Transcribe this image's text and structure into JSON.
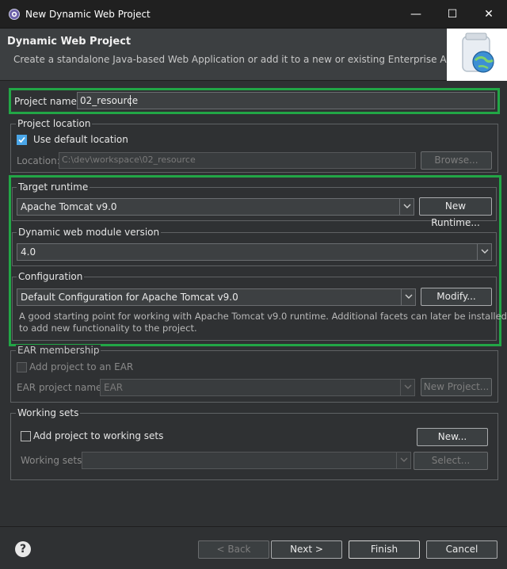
{
  "window": {
    "title": "New Dynamic Web Project",
    "minimize_glyph": "—",
    "maximize_glyph": "☐",
    "close_glyph": "✕"
  },
  "header": {
    "title": "Dynamic Web Project",
    "description": "Create a standalone Java-based Web Application or add it to a new or existing Enterprise Application."
  },
  "project_name": {
    "label": "Project name:",
    "value": "02_resource"
  },
  "project_location": {
    "legend": "Project location",
    "use_default_label": "Use default location",
    "use_default_checked": true,
    "location_label": "Location:",
    "location_value": "C:\\dev\\workspace\\02_resource",
    "browse_label": "Browse..."
  },
  "target_runtime": {
    "legend": "Target runtime",
    "selected": "Apache Tomcat v9.0",
    "new_runtime_label": "New Runtime..."
  },
  "module_version": {
    "legend": "Dynamic web module version",
    "selected": "4.0"
  },
  "configuration": {
    "legend": "Configuration",
    "selected": "Default Configuration for Apache Tomcat v9.0",
    "modify_label": "Modify...",
    "description_line1": "A good starting point for working with Apache Tomcat v9.0 runtime. Additional facets can later be installed",
    "description_line2": "to add new functionality to the project."
  },
  "ear_membership": {
    "legend": "EAR membership",
    "add_label": "Add project to an EAR",
    "add_checked": false,
    "name_label": "EAR project name:",
    "name_value": "EAR",
    "new_project_label": "New Project..."
  },
  "working_sets": {
    "legend": "Working sets",
    "add_label": "Add project to working sets",
    "add_checked": false,
    "new_label": "New...",
    "sets_label": "Working sets:",
    "sets_value": "",
    "select_label": "Select..."
  },
  "footer": {
    "help_glyph": "?",
    "back_label": "< Back",
    "next_label": "Next >",
    "finish_label": "Finish",
    "cancel_label": "Cancel"
  },
  "colors": {
    "highlight_border": "#22a646",
    "checkbox_checked": "#4aa6e8",
    "dialog_background": "#2f3133",
    "titlebar": "#202020"
  }
}
